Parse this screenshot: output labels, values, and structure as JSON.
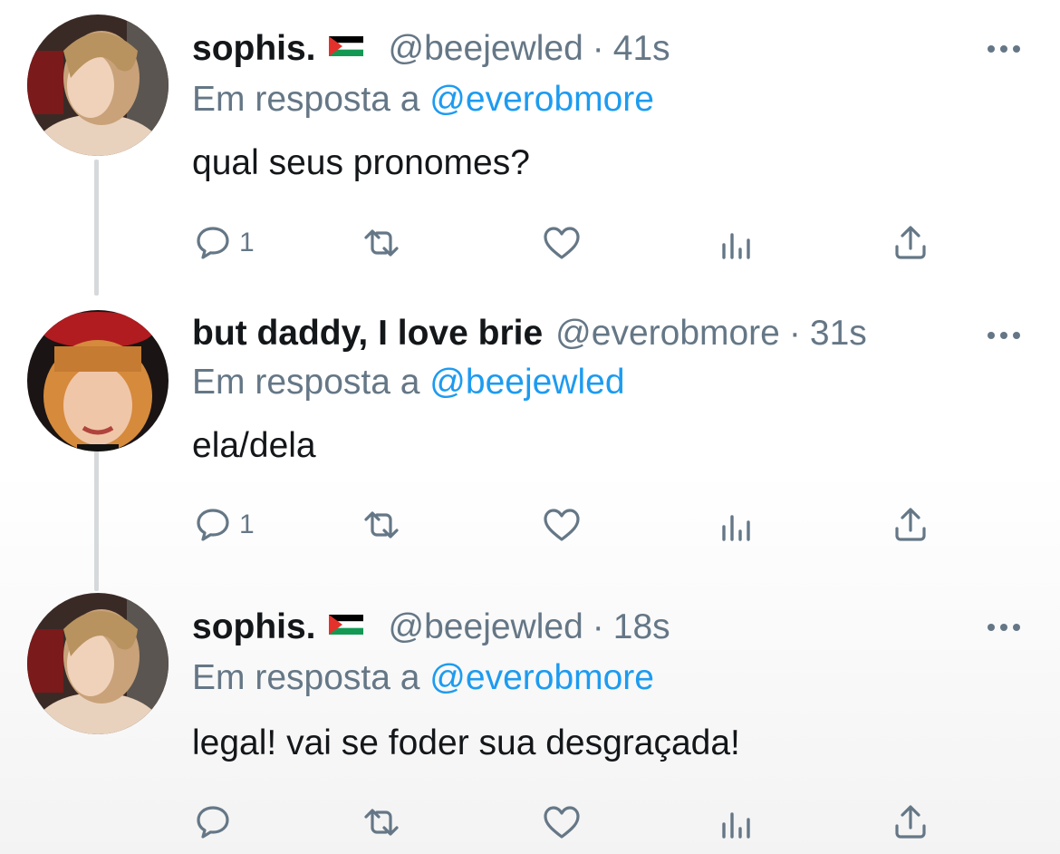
{
  "colors": {
    "text": "#14171a",
    "secondary": "#657786",
    "mention": "#1d9bf0",
    "thread_line": "#d6d9db"
  },
  "icons": [
    "reply-icon",
    "retweet-icon",
    "like-icon",
    "analytics-icon",
    "share-icon",
    "more-icon",
    "palestine-flag-icon"
  ],
  "tweets": [
    {
      "name": "sophis.",
      "has_flag": true,
      "handle": "@beejewled",
      "dot": "·",
      "time": "41s",
      "reply_prefix": "Em resposta a",
      "reply_to": "@everobmore",
      "text": "qual seus pronomes?",
      "reply_count": "1"
    },
    {
      "name": "but daddy, I love brie",
      "has_flag": false,
      "handle": "@everobmore",
      "dot": "·",
      "time": "31s",
      "reply_prefix": "Em resposta a",
      "reply_to": "@beejewled",
      "text": "ela/dela",
      "reply_count": "1"
    },
    {
      "name": "sophis.",
      "has_flag": true,
      "handle": "@beejewled",
      "dot": "·",
      "time": "18s",
      "reply_prefix": "Em resposta a",
      "reply_to": "@everobmore",
      "text": "legal! vai se foder sua desgraçada!",
      "reply_count": ""
    }
  ]
}
